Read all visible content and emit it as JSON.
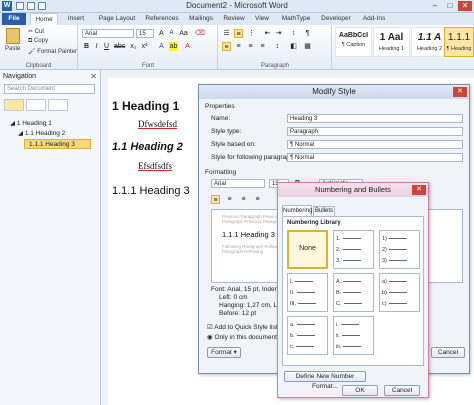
{
  "window": {
    "title": "Document2 - Microsoft Word"
  },
  "tabs": [
    "File",
    "Home",
    "Insert",
    "Page Layout",
    "References",
    "Mailings",
    "Review",
    "View",
    "MathType",
    "Developer",
    "Add-Ins"
  ],
  "clipboard": {
    "paste": "Paste",
    "cut": "Cut",
    "copy": "Copy",
    "format_painter": "Format Painter",
    "label": "Clipboard"
  },
  "font_group": {
    "font": "Arial",
    "size": "15",
    "label": "Font"
  },
  "paragraph_group": {
    "label": "Paragraph"
  },
  "styles": [
    {
      "preview": "AaBbCcI",
      "name": "¶ Caption"
    },
    {
      "preview": "1 Aal",
      "name": "Heading 1"
    },
    {
      "preview": "1.1 A",
      "name": "Heading 2"
    },
    {
      "preview": "1.1.1",
      "name": "¶ Heading"
    }
  ],
  "nav": {
    "title": "Navigation",
    "search_placeholder": "Search Document",
    "items": [
      "1 Heading 1",
      "1.1 Heading 2",
      "1.1.1 Heading 3"
    ]
  },
  "document": {
    "h1": "1  Heading 1",
    "p1": "Dfwsdefsd",
    "h2": "1.1  Heading 2",
    "p2": "Efsdfsdfs",
    "h3": "1.1.1 Heading 3"
  },
  "modify_style": {
    "title": "Modify Style",
    "properties": "Properties",
    "name_label": "Name:",
    "name_value": "Heading 3",
    "type_label": "Style type:",
    "type_value": "Paragraph",
    "based_label": "Style based on:",
    "based_value": "¶ Normal",
    "following_label": "Style for following paragraph:",
    "following_value": "¶ Normal",
    "formatting": "Formatting",
    "font": "Arial",
    "size": "15",
    "color": "Automatic",
    "preview_prev": "Previous Paragraph Previous Paragraph Previous Paragraph",
    "preview_heading": "1.1.1 Heading 3",
    "preview_follow": "Following Paragraph Following Paragraph Following",
    "desc1": "Font: Arial, 15 pt, Inden",
    "desc2": "Left:  0 cm",
    "desc3": "Hanging:  1,27 cm, Le",
    "desc4": "Before:  12 pt",
    "add_quick": "Add to Quick Style list",
    "only_doc": "Only in this document",
    "format_btn": "Format ▾",
    "cancel": "Cancel"
  },
  "numbering": {
    "title": "Numbering and Bullets",
    "tab_numbering": "Numbering",
    "tab_bullets": "Bullets",
    "library": "Numbering Library",
    "none": "None",
    "define": "Define New Number Format...",
    "ok": "OK",
    "cancel": "Cancel",
    "formats": [
      [
        "1.",
        "2.",
        "3."
      ],
      [
        "1)",
        "2)",
        "3)"
      ],
      [
        "I.",
        "II.",
        "III."
      ],
      [
        "A.",
        "B.",
        "C."
      ],
      [
        "a)",
        "b)",
        "c)"
      ],
      [
        "a.",
        "b.",
        "c."
      ],
      [
        "i.",
        "ii.",
        "iii."
      ]
    ]
  }
}
